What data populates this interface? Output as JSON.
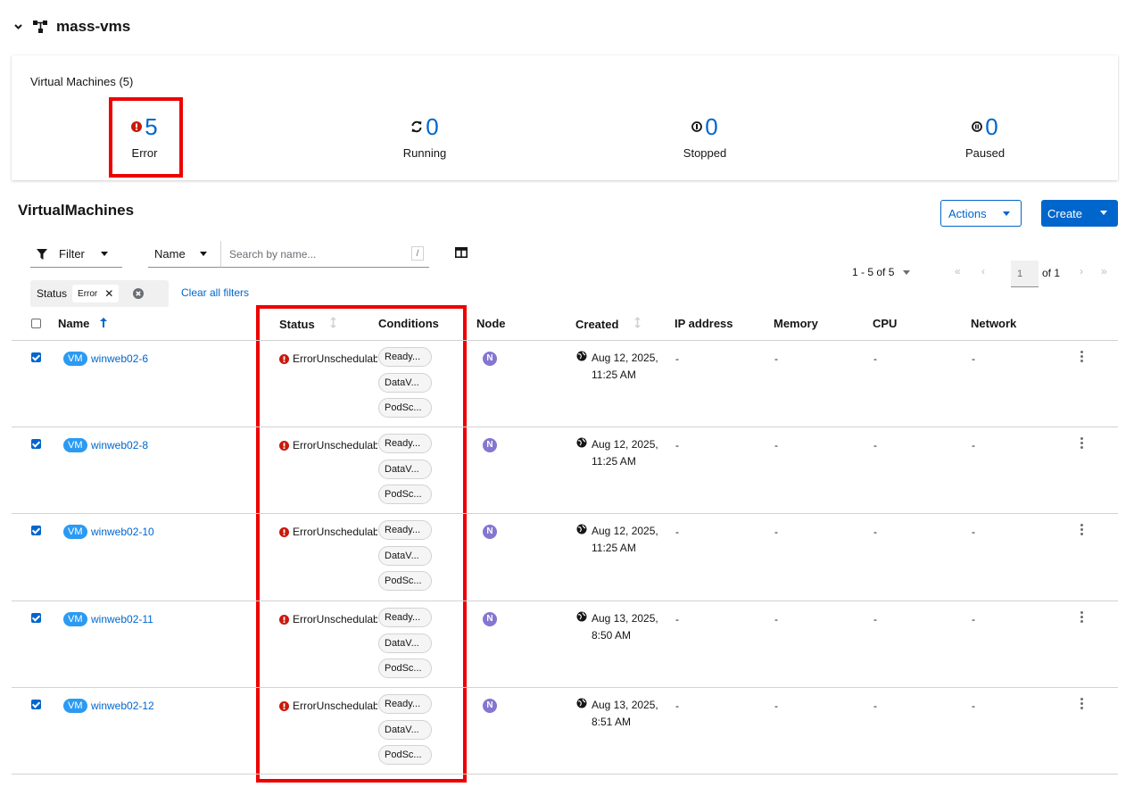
{
  "project": {
    "name": "mass-vms"
  },
  "summary": {
    "title": "Virtual Machines (5)",
    "stats": [
      {
        "value": "5",
        "label": "Error"
      },
      {
        "value": "0",
        "label": "Running"
      },
      {
        "value": "0",
        "label": "Stopped"
      },
      {
        "value": "0",
        "label": "Paused"
      }
    ]
  },
  "section": {
    "title": "VirtualMachines",
    "actions_label": "Actions",
    "create_label": "Create"
  },
  "toolbar": {
    "filter_label": "Filter",
    "search_by": "Name",
    "search_placeholder": "Search by name...",
    "shortcut": "/",
    "pagination_range": "1 - 5 of 5",
    "page_input": "1",
    "page_of": "of 1",
    "chip_category": "Status",
    "chip_value": "Error",
    "clear_all": "Clear all filters"
  },
  "colors": {
    "accent": "#0066cc",
    "error": "#c9190b",
    "highlight": "#ee0000"
  },
  "table": {
    "headers": {
      "name": "Name",
      "status": "Status",
      "conditions": "Conditions",
      "node": "Node",
      "created": "Created",
      "ip": "IP address",
      "memory": "Memory",
      "cpu": "CPU",
      "network": "Network"
    },
    "rows": [
      {
        "badge": "VM",
        "name": "winweb02-6",
        "status": "ErrorUnschedulable",
        "conditions": [
          "Ready...",
          "DataV...",
          "PodSc..."
        ],
        "node": "N",
        "created_date": "Aug 12, 2025,",
        "created_time": "11:25 AM",
        "ip": "-",
        "memory": "-",
        "cpu": "-",
        "network": "-"
      },
      {
        "badge": "VM",
        "name": "winweb02-8",
        "status": "ErrorUnschedulable",
        "conditions": [
          "Ready...",
          "DataV...",
          "PodSc..."
        ],
        "node": "N",
        "created_date": "Aug 12, 2025,",
        "created_time": "11:25 AM",
        "ip": "-",
        "memory": "-",
        "cpu": "-",
        "network": "-"
      },
      {
        "badge": "VM",
        "name": "winweb02-10",
        "status": "ErrorUnschedulable",
        "conditions": [
          "Ready...",
          "DataV...",
          "PodSc..."
        ],
        "node": "N",
        "created_date": "Aug 12, 2025,",
        "created_time": "11:25 AM",
        "ip": "-",
        "memory": "-",
        "cpu": "-",
        "network": "-"
      },
      {
        "badge": "VM",
        "name": "winweb02-11",
        "status": "ErrorUnschedulable",
        "conditions": [
          "Ready...",
          "DataV...",
          "PodSc..."
        ],
        "node": "N",
        "created_date": "Aug 13, 2025,",
        "created_time": "8:50 AM",
        "ip": "-",
        "memory": "-",
        "cpu": "-",
        "network": "-"
      },
      {
        "badge": "VM",
        "name": "winweb02-12",
        "status": "ErrorUnschedulable",
        "conditions": [
          "Ready...",
          "DataV...",
          "PodSc..."
        ],
        "node": "N",
        "created_date": "Aug 13, 2025,",
        "created_time": "8:51 AM",
        "ip": "-",
        "memory": "-",
        "cpu": "-",
        "network": "-"
      }
    ]
  }
}
